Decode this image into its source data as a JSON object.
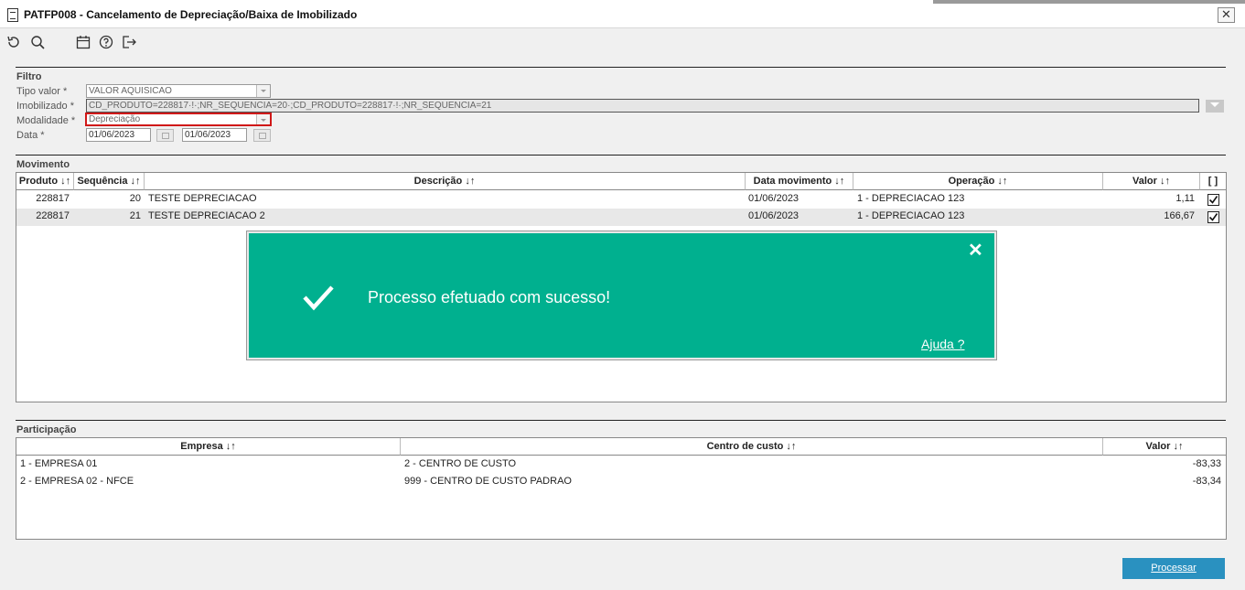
{
  "window": {
    "title": "PATFP008 - Cancelamento de Depreciação/Baixa de Imobilizado",
    "close": "✕"
  },
  "toolbar": {
    "icons": [
      "refresh-icon",
      "search-icon",
      "calendar-icon",
      "help-icon",
      "exit-icon"
    ]
  },
  "filtro": {
    "title": "Filtro",
    "tipo_valor": {
      "label": "Tipo valor *",
      "value": "VALOR AQUISICAO"
    },
    "imobilizado": {
      "label": "Imobilizado *",
      "value": "CD_PRODUTO=228817·!·;NR_SEQUENCIA=20·;CD_PRODUTO=228817·!·;NR_SEQUENCIA=21"
    },
    "modalidade": {
      "label": "Modalidade *",
      "value": "Depreciação"
    },
    "data": {
      "label": "Data *",
      "from": "01/06/2023",
      "to": "01/06/2023"
    }
  },
  "movimento": {
    "title": "Movimento",
    "headers": [
      "Produto ↓↑",
      "Sequência ↓↑",
      "Descrição ↓↑",
      "Data movimento ↓↑",
      "Operação ↓↑",
      "Valor ↓↑",
      "[ ]"
    ],
    "rows": [
      {
        "produto": "228817",
        "sequencia": "20",
        "descricao": "TESTE DEPRECIACAO",
        "data": "01/06/2023",
        "operacao": "1 - DEPRECIACAO 123",
        "valor": "1,11",
        "checked": true
      },
      {
        "produto": "228817",
        "sequencia": "21",
        "descricao": "TESTE DEPRECIACAO 2",
        "data": "01/06/2023",
        "operacao": "1 - DEPRECIACAO 123",
        "valor": "166,67",
        "checked": true
      }
    ]
  },
  "toast": {
    "message": "Processo efetuado com sucesso!",
    "help": "Ajuda ?",
    "close": "✕"
  },
  "participacao": {
    "title": "Participação",
    "headers": [
      "Empresa ↓↑",
      "Centro de custo ↓↑",
      "Valor ↓↑"
    ],
    "rows": [
      {
        "empresa": "1 - EMPRESA 01",
        "centro": "2 - CENTRO DE CUSTO",
        "valor": "-83,33"
      },
      {
        "empresa": "2 - EMPRESA 02 - NFCE",
        "centro": "999 - CENTRO DE CUSTO PADRAO",
        "valor": "-83,34"
      }
    ]
  },
  "actions": {
    "processar": "Processar"
  }
}
